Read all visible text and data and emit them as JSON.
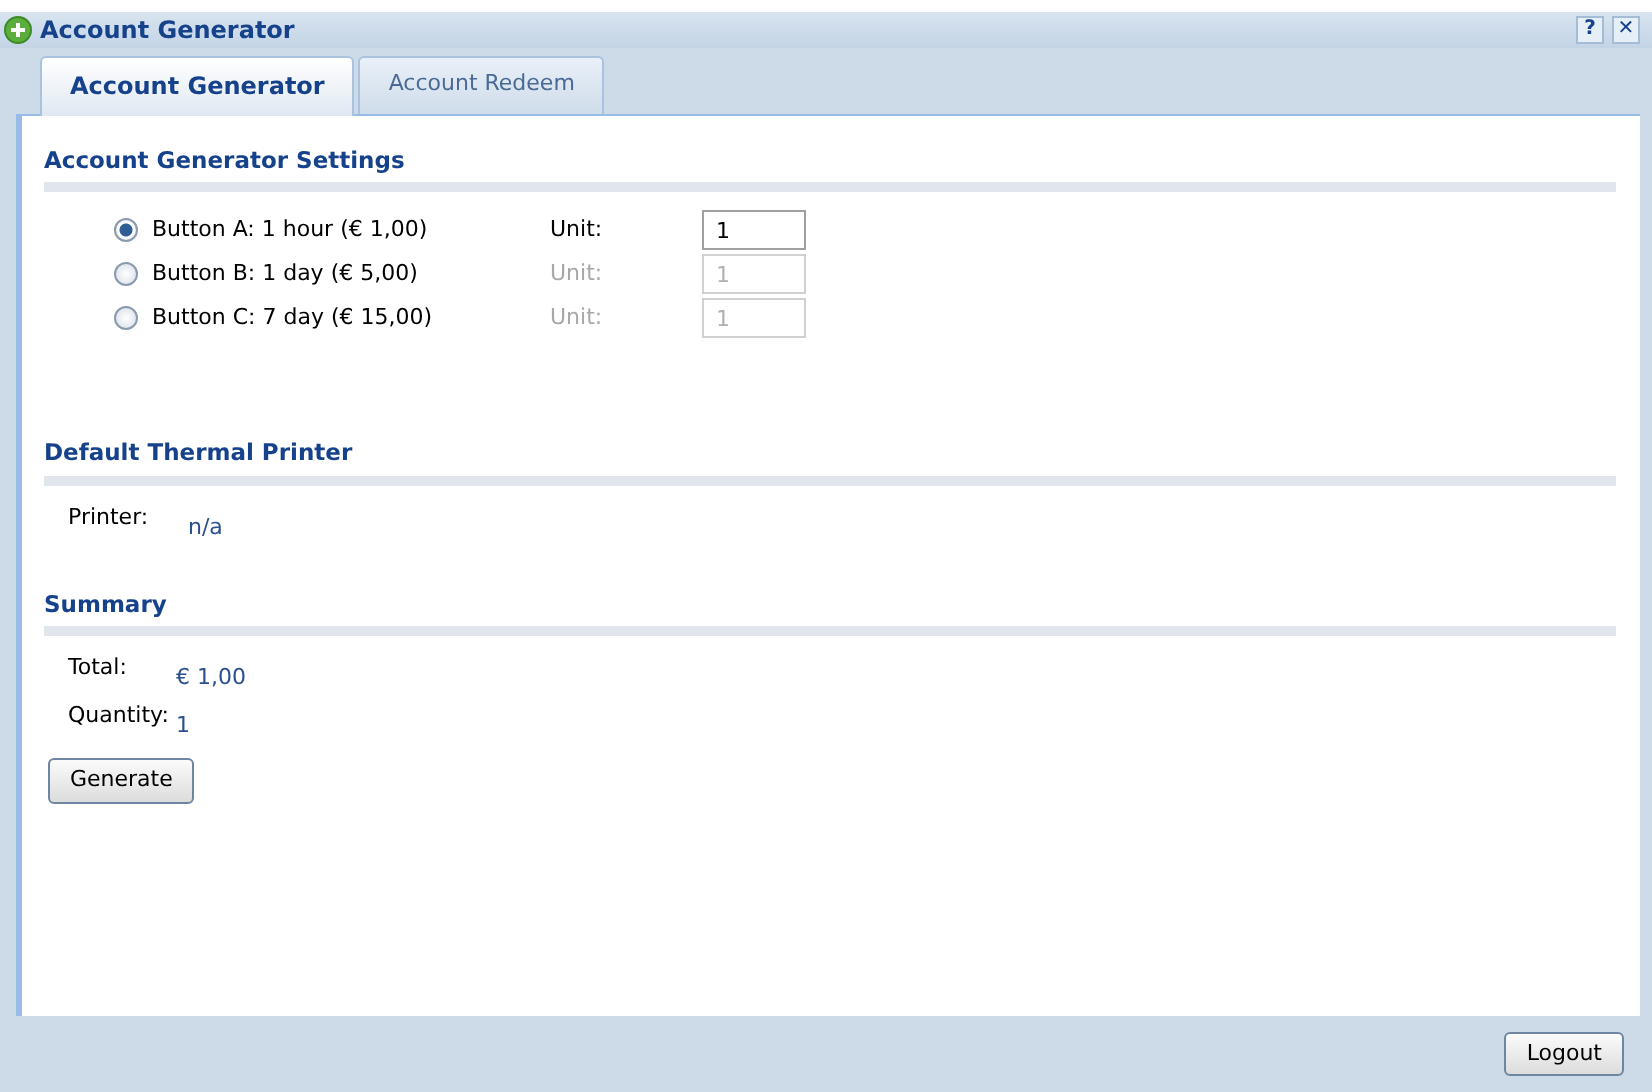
{
  "window": {
    "title": "Account Generator",
    "help": "?",
    "close": "✕"
  },
  "tabs": [
    {
      "label": "Account Generator",
      "selected": true
    },
    {
      "label": "Account Redeem",
      "selected": false
    }
  ],
  "settings": {
    "heading": "Account Generator Settings",
    "options": [
      {
        "label": "Button A: 1 hour (€ 1,00)",
        "selected": true,
        "unit_label": "Unit:",
        "unit_value": "1"
      },
      {
        "label": "Button B: 1 day (€ 5,00)",
        "selected": false,
        "unit_label": "Unit:",
        "unit_value": "1"
      },
      {
        "label": "Button C: 7 day (€ 15,00)",
        "selected": false,
        "unit_label": "Unit:",
        "unit_value": "1"
      }
    ]
  },
  "printer": {
    "heading": "Default Thermal Printer",
    "label": "Printer:",
    "value": "n/a"
  },
  "summary": {
    "heading": "Summary",
    "rows": [
      {
        "label": "Total:",
        "value": "€ 1,00"
      },
      {
        "label": "Quantity:",
        "value": "1"
      }
    ],
    "button": "Generate"
  },
  "footer": {
    "button": "Logout"
  }
}
